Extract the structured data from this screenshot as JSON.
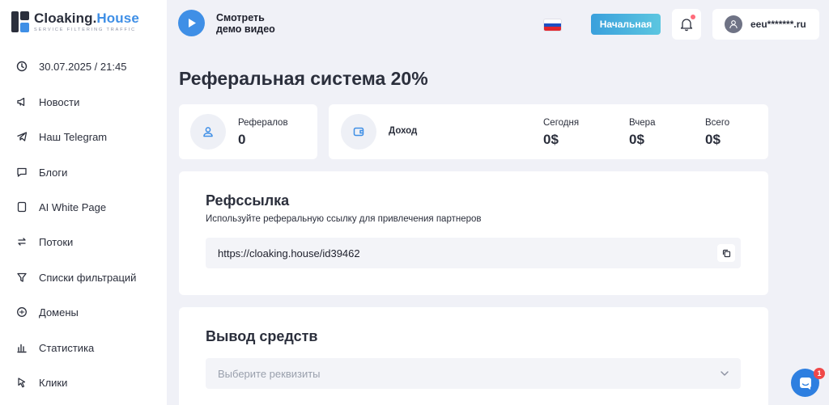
{
  "brand": {
    "name_part1": "Cloaking.",
    "name_part2": "House",
    "tagline": "SERVICE FILTERING TRAFFIC",
    "accent_color": "#3f8fe6"
  },
  "sidebar": {
    "items": [
      {
        "label": "30.07.2025 / 21:45",
        "icon": "clock-icon"
      },
      {
        "label": "Новости",
        "icon": "megaphone-icon"
      },
      {
        "label": "Наш Telegram",
        "icon": "telegram-icon"
      },
      {
        "label": "Блоги",
        "icon": "chat-bubble-icon"
      },
      {
        "label": "AI White Page",
        "icon": "page-icon"
      },
      {
        "label": "Потоки",
        "icon": "flows-icon"
      },
      {
        "label": "Списки фильтраций",
        "icon": "filter-icon"
      },
      {
        "label": "Домены",
        "icon": "domain-icon"
      },
      {
        "label": "Статистика",
        "icon": "bar-chart-icon"
      },
      {
        "label": "Клики",
        "icon": "cursor-icon"
      }
    ]
  },
  "header": {
    "demo_line1": "Смотреть",
    "demo_line2": "демо видео",
    "home_button": "Начальная",
    "user_name": "eeu*******.ru",
    "flag_colors": [
      "#ffffff",
      "#1e4fc2",
      "#e2262d"
    ]
  },
  "page": {
    "title": "Реферальная система 20%"
  },
  "stats": {
    "referrals_label": "Рефералов",
    "referrals_value": "0",
    "income_label": "Доход",
    "today_label": "Сегодня",
    "today_value": "0$",
    "yesterday_label": "Вчера",
    "yesterday_value": "0$",
    "total_label": "Всего",
    "total_value": "0$"
  },
  "reflink": {
    "title": "Рефссылка",
    "description": "Используйте реферальную ссылку для привлечения партнеров",
    "url": "https://cloaking.house/id39462"
  },
  "withdraw": {
    "title": "Вывод средств",
    "select_placeholder": "Выберите реквизиты"
  },
  "chat": {
    "badge_count": "1"
  }
}
